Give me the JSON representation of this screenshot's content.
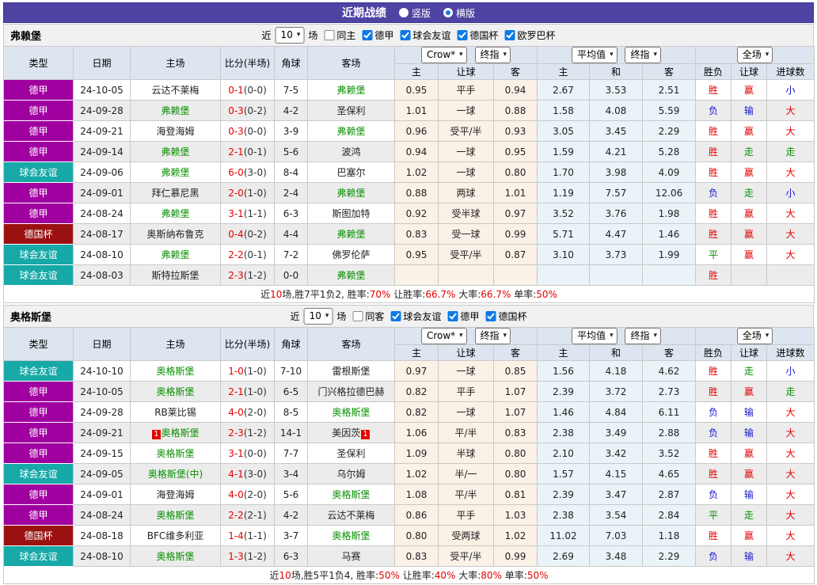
{
  "page": {
    "title": "近期战绩",
    "radios": [
      {
        "label": "竖版",
        "checked": false
      },
      {
        "label": "横版",
        "checked": true
      }
    ]
  },
  "header": {
    "cols": {
      "type": "类型",
      "date": "日期",
      "home": "主场",
      "score": "比分(半场)",
      "corner": "角球",
      "away": "客场"
    },
    "selects": {
      "book": "Crow*",
      "final1": "终指",
      "avg": "平均值",
      "final2": "终指",
      "scope": "全场"
    },
    "sub": [
      "主",
      "让球",
      "客",
      "主",
      "和",
      "客",
      "胜负",
      "让球",
      "进球数"
    ]
  },
  "colors": {
    "types": {
      "德甲": "#a000a0",
      "球会友谊": "#17a8a8",
      "德国杯": "#9b1111"
    },
    "result_red": "#e60000",
    "result_blue": "#1414cc",
    "result_green": "#089000",
    "focal_team": "#089000",
    "titlebar_bg": "#4f43a3",
    "odds_bg": "#faf1e7",
    "avg_bg": "#e9f3f8"
  },
  "sections": [
    {
      "team": "弗赖堡",
      "filter": {
        "near": "近",
        "count": "10",
        "unit": "场",
        "same": "同主",
        "leagues": [
          "德甲",
          "球会友谊",
          "德国杯",
          "欧罗巴杯"
        ]
      },
      "rows": [
        {
          "type": "德甲",
          "date": "24-10-05",
          "home": "云达不莱梅",
          "home_focal": false,
          "home_rc": "",
          "away": "弗赖堡",
          "away_focal": true,
          "away_rc": "",
          "ft": "0-1",
          "ht": "(0-0)",
          "corner": "7-5",
          "odds": [
            "0.95",
            "平手",
            "0.94"
          ],
          "avg": [
            "2.67",
            "3.53",
            "2.51"
          ],
          "res": [
            [
              "胜",
              "r"
            ],
            [
              "赢",
              "r"
            ],
            [
              "小",
              "b"
            ]
          ]
        },
        {
          "type": "德甲",
          "date": "24-09-28",
          "home": "弗赖堡",
          "home_focal": true,
          "home_rc": "",
          "away": "圣保利",
          "away_focal": false,
          "away_rc": "",
          "ft": "0-3",
          "ht": "(0-2)",
          "corner": "4-2",
          "odds": [
            "1.01",
            "一球",
            "0.88"
          ],
          "avg": [
            "1.58",
            "4.08",
            "5.59"
          ],
          "res": [
            [
              "负",
              "b"
            ],
            [
              "输",
              "b"
            ],
            [
              "大",
              "r"
            ]
          ]
        },
        {
          "type": "德甲",
          "date": "24-09-21",
          "home": "海登海姆",
          "home_focal": false,
          "home_rc": "",
          "away": "弗赖堡",
          "away_focal": true,
          "away_rc": "",
          "ft": "0-3",
          "ht": "(0-0)",
          "corner": "3-9",
          "odds": [
            "0.96",
            "受平/半",
            "0.93"
          ],
          "avg": [
            "3.05",
            "3.45",
            "2.29"
          ],
          "res": [
            [
              "胜",
              "r"
            ],
            [
              "赢",
              "r"
            ],
            [
              "大",
              "r"
            ]
          ]
        },
        {
          "type": "德甲",
          "date": "24-09-14",
          "home": "弗赖堡",
          "home_focal": true,
          "home_rc": "",
          "away": "波鸿",
          "away_focal": false,
          "away_rc": "",
          "ft": "2-1",
          "ht": "(0-1)",
          "corner": "5-6",
          "odds": [
            "0.94",
            "一球",
            "0.95"
          ],
          "avg": [
            "1.59",
            "4.21",
            "5.28"
          ],
          "res": [
            [
              "胜",
              "r"
            ],
            [
              "走",
              "g"
            ],
            [
              "走",
              "g"
            ]
          ]
        },
        {
          "type": "球会友谊",
          "date": "24-09-06",
          "home": "弗赖堡",
          "home_focal": true,
          "home_rc": "",
          "away": "巴塞尔",
          "away_focal": false,
          "away_rc": "",
          "ft": "6-0",
          "ht": "(3-0)",
          "corner": "8-4",
          "odds": [
            "1.02",
            "一球",
            "0.80"
          ],
          "avg": [
            "1.70",
            "3.98",
            "4.09"
          ],
          "res": [
            [
              "胜",
              "r"
            ],
            [
              "赢",
              "r"
            ],
            [
              "大",
              "r"
            ]
          ]
        },
        {
          "type": "德甲",
          "date": "24-09-01",
          "home": "拜仁慕尼黑",
          "home_focal": false,
          "home_rc": "",
          "away": "弗赖堡",
          "away_focal": true,
          "away_rc": "",
          "ft": "2-0",
          "ht": "(1-0)",
          "corner": "2-4",
          "odds": [
            "0.88",
            "两球",
            "1.01"
          ],
          "avg": [
            "1.19",
            "7.57",
            "12.06"
          ],
          "res": [
            [
              "负",
              "b"
            ],
            [
              "走",
              "g"
            ],
            [
              "小",
              "b"
            ]
          ]
        },
        {
          "type": "德甲",
          "date": "24-08-24",
          "home": "弗赖堡",
          "home_focal": true,
          "home_rc": "",
          "away": "斯图加特",
          "away_focal": false,
          "away_rc": "",
          "ft": "3-1",
          "ht": "(1-1)",
          "corner": "6-3",
          "odds": [
            "0.92",
            "受半球",
            "0.97"
          ],
          "avg": [
            "3.52",
            "3.76",
            "1.98"
          ],
          "res": [
            [
              "胜",
              "r"
            ],
            [
              "赢",
              "r"
            ],
            [
              "大",
              "r"
            ]
          ]
        },
        {
          "type": "德国杯",
          "date": "24-08-17",
          "home": "奥斯纳布鲁克",
          "home_focal": false,
          "home_rc": "",
          "away": "弗赖堡",
          "away_focal": true,
          "away_rc": "",
          "ft": "0-4",
          "ht": "(0-2)",
          "corner": "4-4",
          "odds": [
            "0.83",
            "受一球",
            "0.99"
          ],
          "avg": [
            "5.71",
            "4.47",
            "1.46"
          ],
          "res": [
            [
              "胜",
              "r"
            ],
            [
              "赢",
              "r"
            ],
            [
              "大",
              "r"
            ]
          ]
        },
        {
          "type": "球会友谊",
          "date": "24-08-10",
          "home": "弗赖堡",
          "home_focal": true,
          "home_rc": "",
          "away": "佛罗伦萨",
          "away_focal": false,
          "away_rc": "",
          "ft": "2-2",
          "ht": "(0-1)",
          "corner": "7-2",
          "odds": [
            "0.95",
            "受平/半",
            "0.87"
          ],
          "avg": [
            "3.10",
            "3.73",
            "1.99"
          ],
          "res": [
            [
              "平",
              "g"
            ],
            [
              "赢",
              "r"
            ],
            [
              "大",
              "r"
            ]
          ]
        },
        {
          "type": "球会友谊",
          "date": "24-08-03",
          "home": "斯特拉斯堡",
          "home_focal": false,
          "home_rc": "",
          "away": "弗赖堡",
          "away_focal": true,
          "away_rc": "",
          "ft": "2-3",
          "ht": "(1-2)",
          "corner": "0-0",
          "odds": [
            "",
            "",
            ""
          ],
          "avg": [
            "",
            "",
            ""
          ],
          "res": [
            [
              "胜",
              "r"
            ],
            [
              "",
              ""
            ],
            [
              "",
              ""
            ]
          ]
        }
      ],
      "summary": [
        [
          "近",
          0
        ],
        [
          "10",
          1
        ],
        [
          "场,胜7平1负2, 胜率:",
          0
        ],
        [
          "70%",
          1
        ],
        [
          " 让胜率:",
          0
        ],
        [
          "66.7%",
          1
        ],
        [
          " 大率:",
          0
        ],
        [
          "66.7%",
          1
        ],
        [
          " 单率:",
          0
        ],
        [
          "50%",
          1
        ]
      ]
    },
    {
      "team": "奥格斯堡",
      "filter": {
        "near": "近",
        "count": "10",
        "unit": "场",
        "same": "同客",
        "leagues": [
          "球会友谊",
          "德甲",
          "德国杯"
        ]
      },
      "rows": [
        {
          "type": "球会友谊",
          "date": "24-10-10",
          "home": "奥格斯堡",
          "home_focal": true,
          "home_rc": "",
          "away": "雷根斯堡",
          "away_focal": false,
          "away_rc": "",
          "ft": "1-0",
          "ht": "(1-0)",
          "corner": "7-10",
          "odds": [
            "0.97",
            "一球",
            "0.85"
          ],
          "avg": [
            "1.56",
            "4.18",
            "4.62"
          ],
          "res": [
            [
              "胜",
              "r"
            ],
            [
              "走",
              "g"
            ],
            [
              "小",
              "b"
            ]
          ]
        },
        {
          "type": "德甲",
          "date": "24-10-05",
          "home": "奥格斯堡",
          "home_focal": true,
          "home_rc": "",
          "away": "门兴格拉德巴赫",
          "away_focal": false,
          "away_rc": "",
          "ft": "2-1",
          "ht": "(1-0)",
          "corner": "6-5",
          "odds": [
            "0.82",
            "平手",
            "1.07"
          ],
          "avg": [
            "2.39",
            "3.72",
            "2.73"
          ],
          "res": [
            [
              "胜",
              "r"
            ],
            [
              "赢",
              "r"
            ],
            [
              "走",
              "g"
            ]
          ]
        },
        {
          "type": "德甲",
          "date": "24-09-28",
          "home": "RB莱比锡",
          "home_focal": false,
          "home_rc": "",
          "away": "奥格斯堡",
          "away_focal": true,
          "away_rc": "",
          "ft": "4-0",
          "ht": "(2-0)",
          "corner": "8-5",
          "odds": [
            "0.82",
            "一球",
            "1.07"
          ],
          "avg": [
            "1.46",
            "4.84",
            "6.11"
          ],
          "res": [
            [
              "负",
              "b"
            ],
            [
              "输",
              "b"
            ],
            [
              "大",
              "r"
            ]
          ]
        },
        {
          "type": "德甲",
          "date": "24-09-21",
          "home": "奥格斯堡",
          "home_focal": true,
          "home_rc": "1",
          "away": "美因茨",
          "away_focal": false,
          "away_rc": "1",
          "ft": "2-3",
          "ht": "(1-2)",
          "corner": "14-1",
          "odds": [
            "1.06",
            "平/半",
            "0.83"
          ],
          "avg": [
            "2.38",
            "3.49",
            "2.88"
          ],
          "res": [
            [
              "负",
              "b"
            ],
            [
              "输",
              "b"
            ],
            [
              "大",
              "r"
            ]
          ]
        },
        {
          "type": "德甲",
          "date": "24-09-15",
          "home": "奥格斯堡",
          "home_focal": true,
          "home_rc": "",
          "away": "圣保利",
          "away_focal": false,
          "away_rc": "",
          "ft": "3-1",
          "ht": "(0-0)",
          "corner": "7-7",
          "odds": [
            "1.09",
            "半球",
            "0.80"
          ],
          "avg": [
            "2.10",
            "3.42",
            "3.52"
          ],
          "res": [
            [
              "胜",
              "r"
            ],
            [
              "赢",
              "r"
            ],
            [
              "大",
              "r"
            ]
          ]
        },
        {
          "type": "球会友谊",
          "date": "24-09-05",
          "home": "奥格斯堡(中)",
          "home_focal": true,
          "home_rc": "",
          "away": "乌尔姆",
          "away_focal": false,
          "away_rc": "",
          "ft": "4-1",
          "ht": "(3-0)",
          "corner": "3-4",
          "odds": [
            "1.02",
            "半/一",
            "0.80"
          ],
          "avg": [
            "1.57",
            "4.15",
            "4.65"
          ],
          "res": [
            [
              "胜",
              "r"
            ],
            [
              "赢",
              "r"
            ],
            [
              "大",
              "r"
            ]
          ]
        },
        {
          "type": "德甲",
          "date": "24-09-01",
          "home": "海登海姆",
          "home_focal": false,
          "home_rc": "",
          "away": "奥格斯堡",
          "away_focal": true,
          "away_rc": "",
          "ft": "4-0",
          "ht": "(2-0)",
          "corner": "5-6",
          "odds": [
            "1.08",
            "平/半",
            "0.81"
          ],
          "avg": [
            "2.39",
            "3.47",
            "2.87"
          ],
          "res": [
            [
              "负",
              "b"
            ],
            [
              "输",
              "b"
            ],
            [
              "大",
              "r"
            ]
          ]
        },
        {
          "type": "德甲",
          "date": "24-08-24",
          "home": "奥格斯堡",
          "home_focal": true,
          "home_rc": "",
          "away": "云达不莱梅",
          "away_focal": false,
          "away_rc": "",
          "ft": "2-2",
          "ht": "(2-1)",
          "corner": "4-2",
          "odds": [
            "0.86",
            "平手",
            "1.03"
          ],
          "avg": [
            "2.38",
            "3.54",
            "2.84"
          ],
          "res": [
            [
              "平",
              "g"
            ],
            [
              "走",
              "g"
            ],
            [
              "大",
              "r"
            ]
          ]
        },
        {
          "type": "德国杯",
          "date": "24-08-18",
          "home": "BFC维多利亚",
          "home_focal": false,
          "home_rc": "",
          "away": "奥格斯堡",
          "away_focal": true,
          "away_rc": "",
          "ft": "1-4",
          "ht": "(1-1)",
          "corner": "3-7",
          "odds": [
            "0.80",
            "受两球",
            "1.02"
          ],
          "avg": [
            "11.02",
            "7.03",
            "1.18"
          ],
          "res": [
            [
              "胜",
              "r"
            ],
            [
              "赢",
              "r"
            ],
            [
              "大",
              "r"
            ]
          ]
        },
        {
          "type": "球会友谊",
          "date": "24-08-10",
          "home": "奥格斯堡",
          "home_focal": true,
          "home_rc": "",
          "away": "马赛",
          "away_focal": false,
          "away_rc": "",
          "ft": "1-3",
          "ht": "(1-2)",
          "corner": "6-3",
          "odds": [
            "0.83",
            "受平/半",
            "0.99"
          ],
          "avg": [
            "2.69",
            "3.48",
            "2.29"
          ],
          "res": [
            [
              "负",
              "b"
            ],
            [
              "输",
              "b"
            ],
            [
              "大",
              "r"
            ]
          ]
        }
      ],
      "summary": [
        [
          "近",
          0
        ],
        [
          "10",
          1
        ],
        [
          "场,胜5平1负4, 胜率:",
          0
        ],
        [
          "50%",
          1
        ],
        [
          " 让胜率:",
          0
        ],
        [
          "40%",
          1
        ],
        [
          " 大率:",
          0
        ],
        [
          "80%",
          1
        ],
        [
          " 单率:",
          0
        ],
        [
          "50%",
          1
        ]
      ]
    }
  ]
}
